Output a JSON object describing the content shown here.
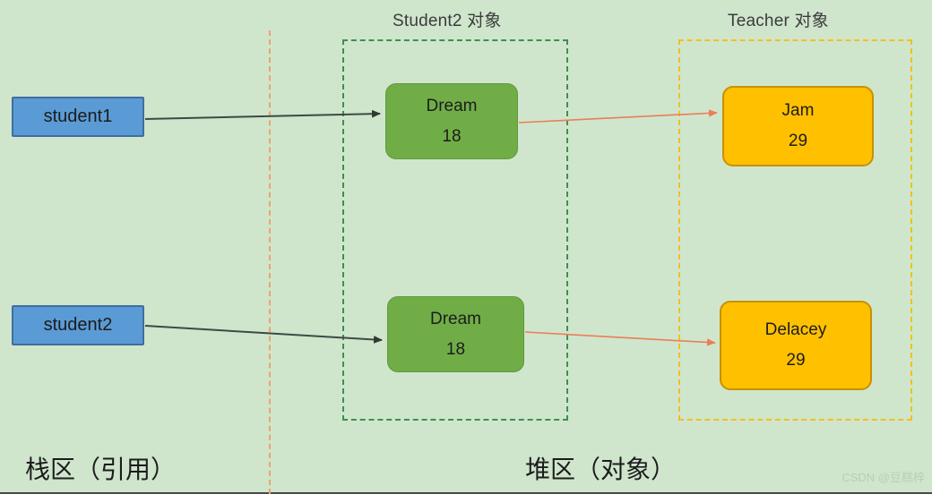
{
  "diagram": {
    "background_color": "#cfe6cd",
    "region_titles": {
      "student2": "Student2 对象",
      "teacher": "Teacher 对象"
    },
    "areas": {
      "stack_caption": "栈区（引用）",
      "heap_caption": "堆区（对象）"
    },
    "nodes": {
      "student1_ref": {
        "label": "student1",
        "color": "#5b9bd5"
      },
      "student2_ref": {
        "label": "student2",
        "color": "#5b9bd5"
      },
      "dream_object_1": {
        "name": "Dream",
        "age": "18",
        "color": "#70ad47"
      },
      "dream_object_2": {
        "name": "Dream",
        "age": "18",
        "color": "#70ad47"
      },
      "jam_object": {
        "name": "Jam",
        "age": "29",
        "color": "#ffc000"
      },
      "delacey_object": {
        "name": "Delacey",
        "age": "29",
        "color": "#bf8f00"
      }
    },
    "arrows": {
      "ref_arrow_color": "#3f4a42",
      "obj_arrow_color": "#ed7d56"
    },
    "watermark": "CSDN @豆糕梓"
  }
}
